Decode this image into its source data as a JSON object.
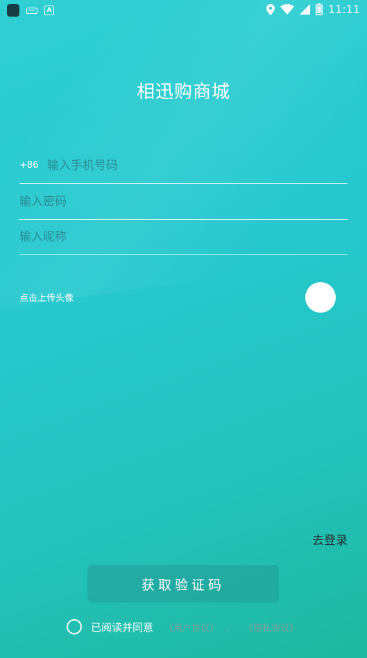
{
  "status_bar": {
    "time": "11:11",
    "icons": [
      "app-square-icon",
      "keyboard-icon",
      "a-badge-icon",
      "location-pin-icon",
      "wifi-icon",
      "signal-icon",
      "battery-icon"
    ]
  },
  "app": {
    "title": "相迅购商城"
  },
  "form": {
    "phone_prefix": "+86",
    "phone_placeholder": "输入手机号码",
    "password_placeholder": "输入密码",
    "nickname_placeholder": "输入昵称",
    "avatar_label": "点击上传头像"
  },
  "actions": {
    "goto_login": "去登录",
    "get_code": "获取验证码"
  },
  "agreement": {
    "agree_text": "已阅读并同意",
    "user_agreement": "《用户协议》",
    "separator": "、",
    "privacy_policy": "《隐私协议》"
  },
  "colors": {
    "background_top": "#2fcfd2",
    "background_bottom": "#1fb89f",
    "text": "#ffffff",
    "login_link": "#1d2b2b"
  }
}
